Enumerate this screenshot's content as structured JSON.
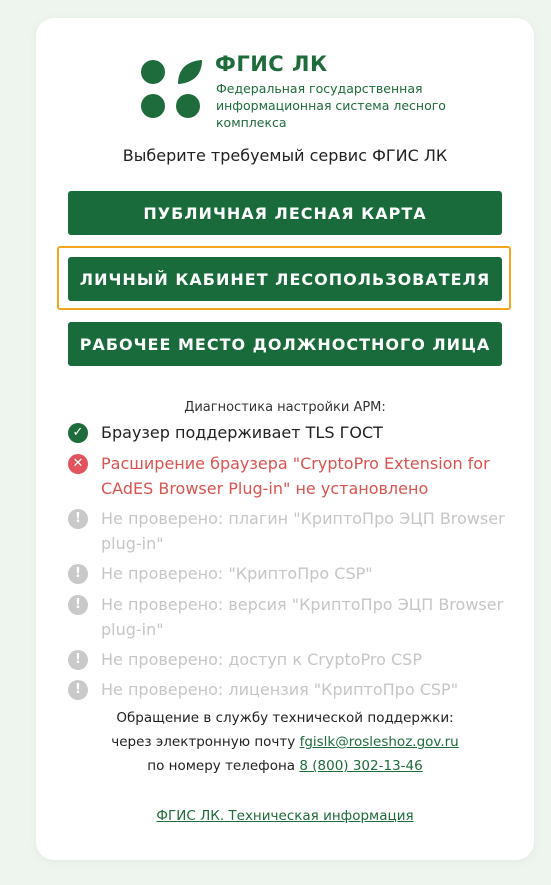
{
  "logo": {
    "title": "ФГИС ЛК",
    "subtitle": "Федеральная государственная информационная система лесного комплекса",
    "brand_color": "#1e6b3b"
  },
  "prompt": "Выберите требуемый сервис ФГИС ЛК",
  "buttons": [
    {
      "label": "ПУБЛИЧНАЯ ЛЕСНАЯ КАРТА"
    },
    {
      "label": "ЛИЧНЫЙ КАБИНЕТ ЛЕСОПОЛЬЗОВАТЕЛЯ",
      "focused": true
    },
    {
      "label": "РАБОЧЕЕ МЕСТО ДОЛЖНОСТНОГО ЛИЦА"
    }
  ],
  "diagnostics": {
    "title": "Диагностика настройки АРМ:",
    "items": [
      {
        "status": "ok",
        "icon": "check-circle-icon",
        "text": "Браузер поддерживает TLS ГОСТ"
      },
      {
        "status": "error",
        "icon": "x-circle-icon",
        "text": "Расширение браузера \"CryptoPro Extension for CAdES Browser Plug-in\" не установлено"
      },
      {
        "status": "unchecked",
        "icon": "exclamation-circle-icon",
        "text": "Не проверено: плагин \"КриптоПро ЭЦП Browser plug-in\""
      },
      {
        "status": "unchecked",
        "icon": "exclamation-circle-icon",
        "text": "Не проверено: \"КриптоПро CSP\""
      },
      {
        "status": "unchecked",
        "icon": "exclamation-circle-icon",
        "text": "Не проверено: версия \"КриптоПро ЭЦП Browser plug-in\""
      },
      {
        "status": "unchecked",
        "icon": "exclamation-circle-icon",
        "text": "Не проверено: доступ к CryptoPro CSP"
      },
      {
        "status": "unchecked",
        "icon": "exclamation-circle-icon",
        "text": "Не проверено: лицензия \"КриптоПро CSP\""
      }
    ]
  },
  "support": {
    "line1": "Обращение в службу технической поддержки:",
    "email_prefix": "через электронную почту",
    "email": "fgislk@rosleshoz.gov.ru",
    "phone_prefix": "по номеру телефона",
    "phone": "8 (800) 302-13-46"
  },
  "tech_info_link": "ФГИС ЛК. Техническая информация",
  "colors": {
    "button_bg": "#196b3b",
    "focus_ring": "#f2a61f",
    "error_text": "#d9534f",
    "unchecked_text": "#c6c6c6"
  }
}
